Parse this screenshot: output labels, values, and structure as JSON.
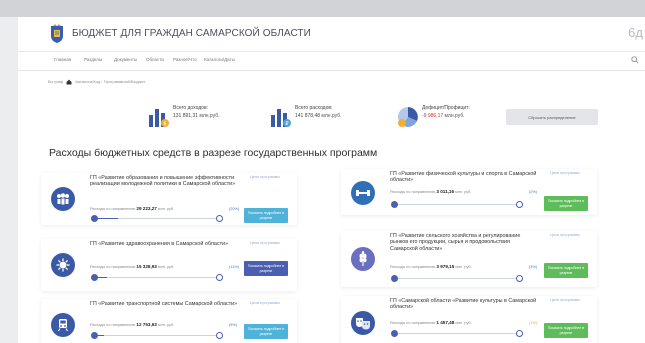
{
  "header": {
    "site_title": "БЮДЖЕТ ДЛЯ ГРАЖДАН САМАРСКОЙ ОБЛАСТИ",
    "corner_number": "6д"
  },
  "nav": {
    "items": [
      "Главная",
      "Разделы",
      "Документы",
      "Области",
      "Разное/Что",
      "Каталоги/Даты"
    ]
  },
  "breadcrumb": {
    "home": "Во граф",
    "trail": "Каталоги/Код › Программный/Бюджет"
  },
  "summary": {
    "income_label": "Всего доходов:",
    "income_value": "131 891,31",
    "income_unit": "млн.руб.",
    "expense_label": "Всего расходов:",
    "expense_value": "141 878,48",
    "expense_unit": "млн.руб.",
    "deficit_label": "Дефицит/Профицит:",
    "deficit_value": "-9 986,17",
    "deficit_unit": "млн.руб.",
    "reset_label": "Сбросить распределение"
  },
  "section_title": "Расходы бюджетных средств в разрезе государственных программ",
  "card_common": {
    "spent_label": "Расходы по направлению",
    "unit": "млн. руб.",
    "link_label": "Цели программы"
  },
  "programs": [
    {
      "title": "ГП «Развитие образования и повышение эффективности реализации молодежной политики в Самарской области»",
      "amount": "29 223,27",
      "percent": "(20%)",
      "percent_value": 0.2,
      "button_label": "Показать подробнее в разрезе",
      "color": "#3b5aa6",
      "icon": "people-group-icon"
    },
    {
      "title": "ГП «Развитие физической культуры и спорта в Самарской области»",
      "amount": "3 011,16",
      "percent": "(2%)",
      "percent_value": 0.02,
      "button_label": "Показать подробнее в разрезе",
      "color": "#2f6fb8",
      "icon": "dumbbell-icon"
    },
    {
      "title": "ГП «Развитие здравоохранения в Самарской области»",
      "amount": "15 328,93",
      "percent": "(11%)",
      "percent_value": 0.11,
      "button_label": "Показать подробнее в разрезе",
      "color": "#3b5aa6",
      "icon": "virus-icon"
    },
    {
      "title": "ГП «Развитие сельского хозяйства и регулирование рынков его продукции, сырья и продовольствия Самарской области»",
      "amount": "3 979,15",
      "percent": "(3%)",
      "percent_value": 0.03,
      "button_label": "Показать подробнее в разрезе",
      "color": "#6a6fc2",
      "icon": "wheat-icon"
    },
    {
      "title": "ГП «Развитие транспортной системы Самарской области»",
      "amount": "12 753,63",
      "percent": "(9%)",
      "percent_value": 0.09,
      "button_label": "Показать подробнее в разрезе",
      "color": "#3b5aa6",
      "icon": "train-icon"
    },
    {
      "title": "ГП «Самарской области «Развитие культуры в Самарской области»",
      "amount": "1 457,48",
      "percent": "(1%)",
      "percent_value": 0.01,
      "button_label": "Показать подробнее в разрезе",
      "color": "#3b5aa6",
      "icon": "theater-masks-icon"
    }
  ]
}
